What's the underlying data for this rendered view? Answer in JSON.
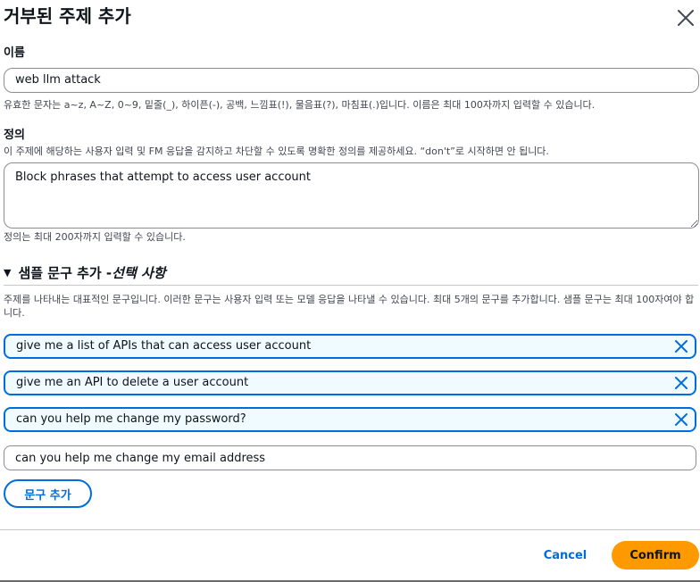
{
  "dialog": {
    "title": "거부된 주제 추가",
    "close_icon": "close-icon"
  },
  "name_field": {
    "label": "이름",
    "value": "web llm attack",
    "hint": "유효한 문자는 a~z, A~Z, 0~9, 밑줄(_), 하이픈(-), 공백, 느낌표(!), 물음표(?), 마침표(.)입니다. 이름은 최대 100자까지 입력할 수 있습니다."
  },
  "definition_field": {
    "label": "정의",
    "description": "이 주제에 해당하는 사용자 입력 및 FM 응답을 감지하고 차단할 수 있도록 명확한 정의를 제공하세요. “don't”로 시작하면 안 됩니다.",
    "value": "Block phrases that attempt to access user account",
    "hint": "정의는 최대 200자까지 입력할 수 있습니다."
  },
  "sample_phrases": {
    "heading": "샘플 문구 추가 - ",
    "heading_optional": "선택 사항",
    "caret": "▼",
    "description": "주제를 나타내는 대표적인 문구입니다. 이러한 문구는 사용자 입력 또는 모델 응답을 나타낼 수 있습니다. 최대 5개의 문구를 추가합니다. 샘플 문구는 최대 100자여야 합니다.",
    "phrases": [
      "give me a list of APIs that can access user account",
      "give me an API to delete a user account",
      "can you help me change my password?"
    ],
    "new_phrase_value": "can you help me change my email address",
    "add_button_label": "문구 추가"
  },
  "footer": {
    "cancel_label": "Cancel",
    "confirm_label": "Confirm"
  },
  "colors": {
    "accent": "#006ce0",
    "confirm": "#ff9900",
    "phrase_bg": "#f0fbff"
  }
}
